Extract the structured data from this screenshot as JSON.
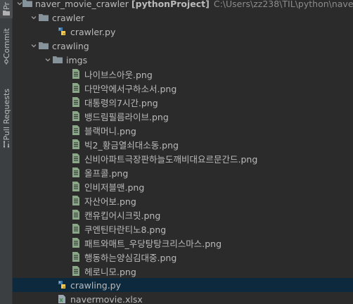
{
  "side_tabs": {
    "project": "Pr",
    "commit": "Commit",
    "pull_requests": "Pull Requests"
  },
  "tree": {
    "root": {
      "name": "naver_movie_crawler",
      "project": "[pythonProject]",
      "path": "C:\\Users\\zz238\\TIL\\python\\naver_mov"
    },
    "crawler_folder": "crawler",
    "crawler_py": "crawler.py",
    "crawling_folder": "crawling",
    "imgs_folder": "imgs",
    "images": [
      "나이브스아웃.png",
      "다만악에서구하소서.png",
      "대통령의7시간.png",
      "뱅드림필름라이브.png",
      "블랙머니.png",
      "빅2_황금열쇠대소동.png",
      "신비아파트극장판하늘도깨비대요르문간드.png",
      "올프콜.png",
      "인비저블맨.png",
      "자산어보.png",
      "캔유킵어시크릿.png",
      "쿠엔틴타란티노8.png",
      "패트와매트_우당탕탕크리스마스.png",
      "행동하는양심김대중.png",
      "헤로니모.png"
    ],
    "crawling_py": "crawling.py",
    "xlsx": "navermovie.xlsx"
  },
  "colors": {
    "folder": "#87939a",
    "python_blue": "#3c77a8",
    "python_yellow": "#f2c94c",
    "image_file": "#8aa888",
    "excel_green": "#4a8c57",
    "selection": "#0d293e"
  }
}
